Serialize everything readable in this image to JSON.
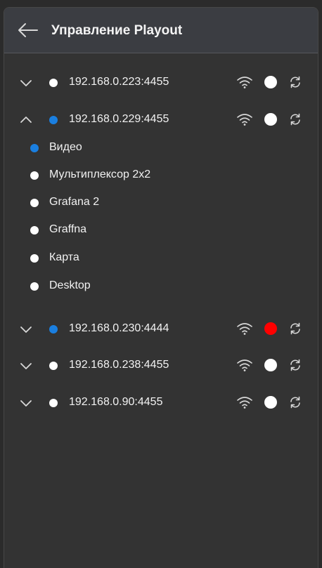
{
  "colors": {
    "active": "#1a7fe0",
    "idle": "#ffffff",
    "error": "#ff0000"
  },
  "header": {
    "back_icon": "arrow-left-icon",
    "title": "Управление Playout"
  },
  "devices": [
    {
      "address": "192.168.0.223:4455",
      "expanded": false,
      "indicator": "idle",
      "status": "idle",
      "icons": [
        "chevron-down-icon",
        "wifi-icon",
        "refresh-icon"
      ]
    },
    {
      "address": "192.168.0.229:4455",
      "expanded": true,
      "indicator": "active",
      "status": "idle",
      "icons": [
        "chevron-up-icon",
        "wifi-icon",
        "refresh-icon"
      ],
      "scenes": [
        {
          "label": "Видео",
          "active": true
        },
        {
          "label": "Мультиплексор 2x2",
          "active": false
        },
        {
          "label": "Grafana 2",
          "active": false
        },
        {
          "label": "Graffna",
          "active": false
        },
        {
          "label": "Карта",
          "active": false
        },
        {
          "label": "Desktop",
          "active": false
        }
      ]
    },
    {
      "address": "192.168.0.230:4444",
      "expanded": false,
      "indicator": "active",
      "status": "error",
      "icons": [
        "chevron-down-icon",
        "wifi-icon",
        "refresh-icon"
      ]
    },
    {
      "address": "192.168.0.238:4455",
      "expanded": false,
      "indicator": "idle",
      "status": "idle",
      "icons": [
        "chevron-down-icon",
        "wifi-icon",
        "refresh-icon"
      ]
    },
    {
      "address": "192.168.0.90:4455",
      "expanded": false,
      "indicator": "idle",
      "status": "idle",
      "icons": [
        "chevron-down-icon",
        "wifi-icon",
        "refresh-icon"
      ]
    }
  ]
}
